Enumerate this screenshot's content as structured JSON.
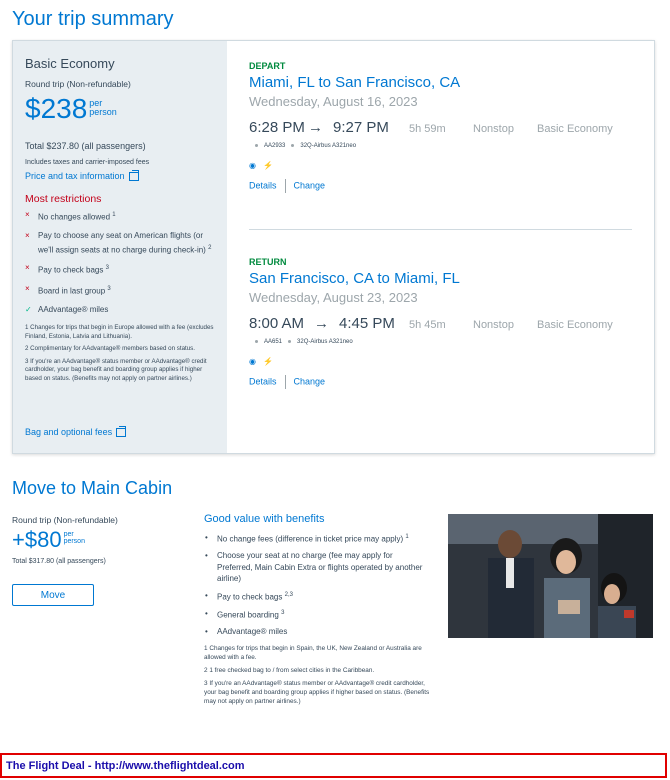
{
  "page_title": "Your trip summary",
  "summary": {
    "fare_name": "Basic Economy",
    "trip_type": "Round trip (Non-refundable)",
    "price": "$238",
    "per_line1": "per",
    "per_line2": "person",
    "total": "Total $237.80 (all passengers)",
    "taxes_note": "Includes taxes and carrier-imposed fees",
    "price_tax_link": "Price and tax information",
    "restrictions_title": "Most restrictions",
    "restrictions": [
      {
        "text": "No changes allowed",
        "sup": "1",
        "mark": "×"
      },
      {
        "text": "Pay to choose any seat on American flights (or we'll assign seats at no charge during check-in)",
        "sup": "2",
        "mark": "×"
      },
      {
        "text": "Pay to check bags",
        "sup": "3",
        "mark": "×"
      },
      {
        "text": "Board in last group",
        "sup": "3",
        "mark": "×"
      },
      {
        "text": "AAdvantage® miles",
        "sup": "",
        "mark": "✓"
      }
    ],
    "notes": [
      "1 Changes for trips that begin in Europe allowed with a fee (excludes Finland, Estonia, Latvia and Lithuania).",
      "2 Complimentary for AAdvantage® members based on status.",
      "3 If you're an AAdvantage® status member or AAdvantage® credit cardholder, your bag benefit and boarding group applies if higher based on status. (Benefits may not apply on partner airlines.)"
    ],
    "bag_link": "Bag and optional fees"
  },
  "depart": {
    "label": "DEPART",
    "route": "Miami, FL to San Francisco, CA",
    "date": "Wednesday, August 16, 2023",
    "dep_time": "6:28 PM",
    "arr_time": "9:27 PM",
    "arrow": "→",
    "duration": "5h 59m",
    "stops": "Nonstop",
    "cabin": "Basic Economy",
    "flight_no": "AA2933",
    "aircraft": "32Q-Airbus A321neo",
    "details": "Details",
    "change": "Change"
  },
  "return": {
    "label": "RETURN",
    "route": "San Francisco, CA to Miami, FL",
    "date": "Wednesday, August 23, 2023",
    "dep_time": "8:00 AM",
    "arr_time": "4:45 PM",
    "arrow": "→",
    "duration": "5h 45m",
    "stops": "Nonstop",
    "cabin": "Basic Economy",
    "flight_no": "AA651",
    "aircraft": "32Q-Airbus A321neo",
    "details": "Details",
    "change": "Change"
  },
  "main_cabin": {
    "title": "Move to Main Cabin",
    "trip_type": "Round trip (Non-refundable)",
    "price": "+$80",
    "per_line1": "per",
    "per_line2": "person",
    "total": "Total $317.80 (all passengers)",
    "move_button": "Move",
    "benefits_title": "Good value with benefits",
    "benefits": [
      {
        "text": "No change fees (difference in ticket price may apply)",
        "sup": "1"
      },
      {
        "text": "Choose your seat at no charge (fee may apply for Preferred, Main Cabin Extra or flights operated by another airline)",
        "sup": ""
      },
      {
        "text": "Pay to check bags",
        "sup": "2,3"
      },
      {
        "text": "General boarding",
        "sup": "3"
      },
      {
        "text": "AAdvantage® miles",
        "sup": ""
      }
    ],
    "notes": [
      "1 Changes for trips that begin in Spain, the UK, New Zealand or Australia are allowed with a fee.",
      "2 1 free checked bag to / from select cities in the Caribbean.",
      "3 If you're an AAdvantage® status member or AAdvantage® credit cardholder, your bag benefit and boarding group applies if higher based on status. (Benefits may not apply on partner airlines.)"
    ]
  },
  "banner": "The Flight Deal - http://www.theflightdeal.com",
  "colors": {
    "accent": "#0078d2",
    "restriction": "#c30019",
    "depart_label": "#008a3e",
    "check": "#00b989"
  }
}
